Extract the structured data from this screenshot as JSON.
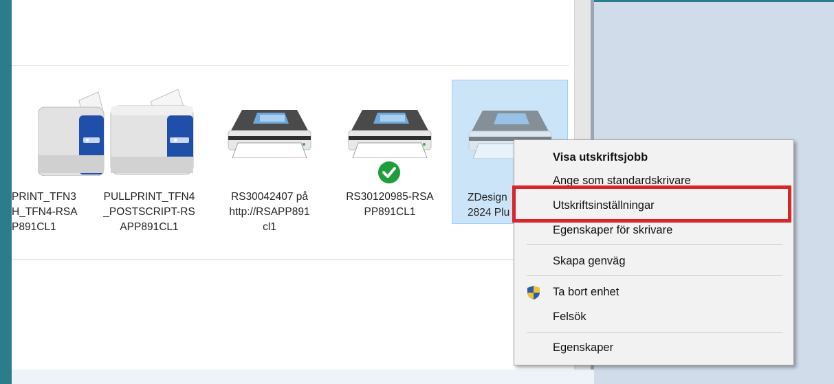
{
  "devices": [
    {
      "label": "PRINT_TFN3\nH_TFN4-RSA\nP891CL1",
      "icon": "printer-blue-icon",
      "default": false
    },
    {
      "label": "PULLPRINT_TFN4\n_POSTSCRIPT-RS\nAPP891CL1",
      "icon": "printer-blue-icon",
      "default": false
    },
    {
      "label": "RS30042407 på\nhttp://RSAPP891\ncl1",
      "icon": "printer-icon",
      "default": false
    },
    {
      "label": "RS30120985-RSA\nPP891CL1",
      "icon": "printer-icon",
      "default": true
    },
    {
      "label": "ZDesign\n2824 Plu",
      "icon": "printer-icon",
      "default": false,
      "selected": true
    }
  ],
  "context_menu": {
    "items": [
      {
        "label": "Visa utskriftsjobb",
        "bold": true
      },
      {
        "label": "Ange som standardskrivare"
      },
      {
        "label": "Utskriftsinställningar",
        "highlighted": true
      },
      {
        "label": "Egenskaper för skrivare"
      },
      {
        "label": "Skapa genväg"
      },
      {
        "label": "Ta bort enhet",
        "icon": "uac-shield-icon"
      },
      {
        "label": "Felsök"
      },
      {
        "label": "Egenskaper"
      }
    ]
  },
  "colors": {
    "highlight_border": "#d9262b",
    "selection_bg": "#cce4f7",
    "default_check": "#1e9e3a"
  }
}
